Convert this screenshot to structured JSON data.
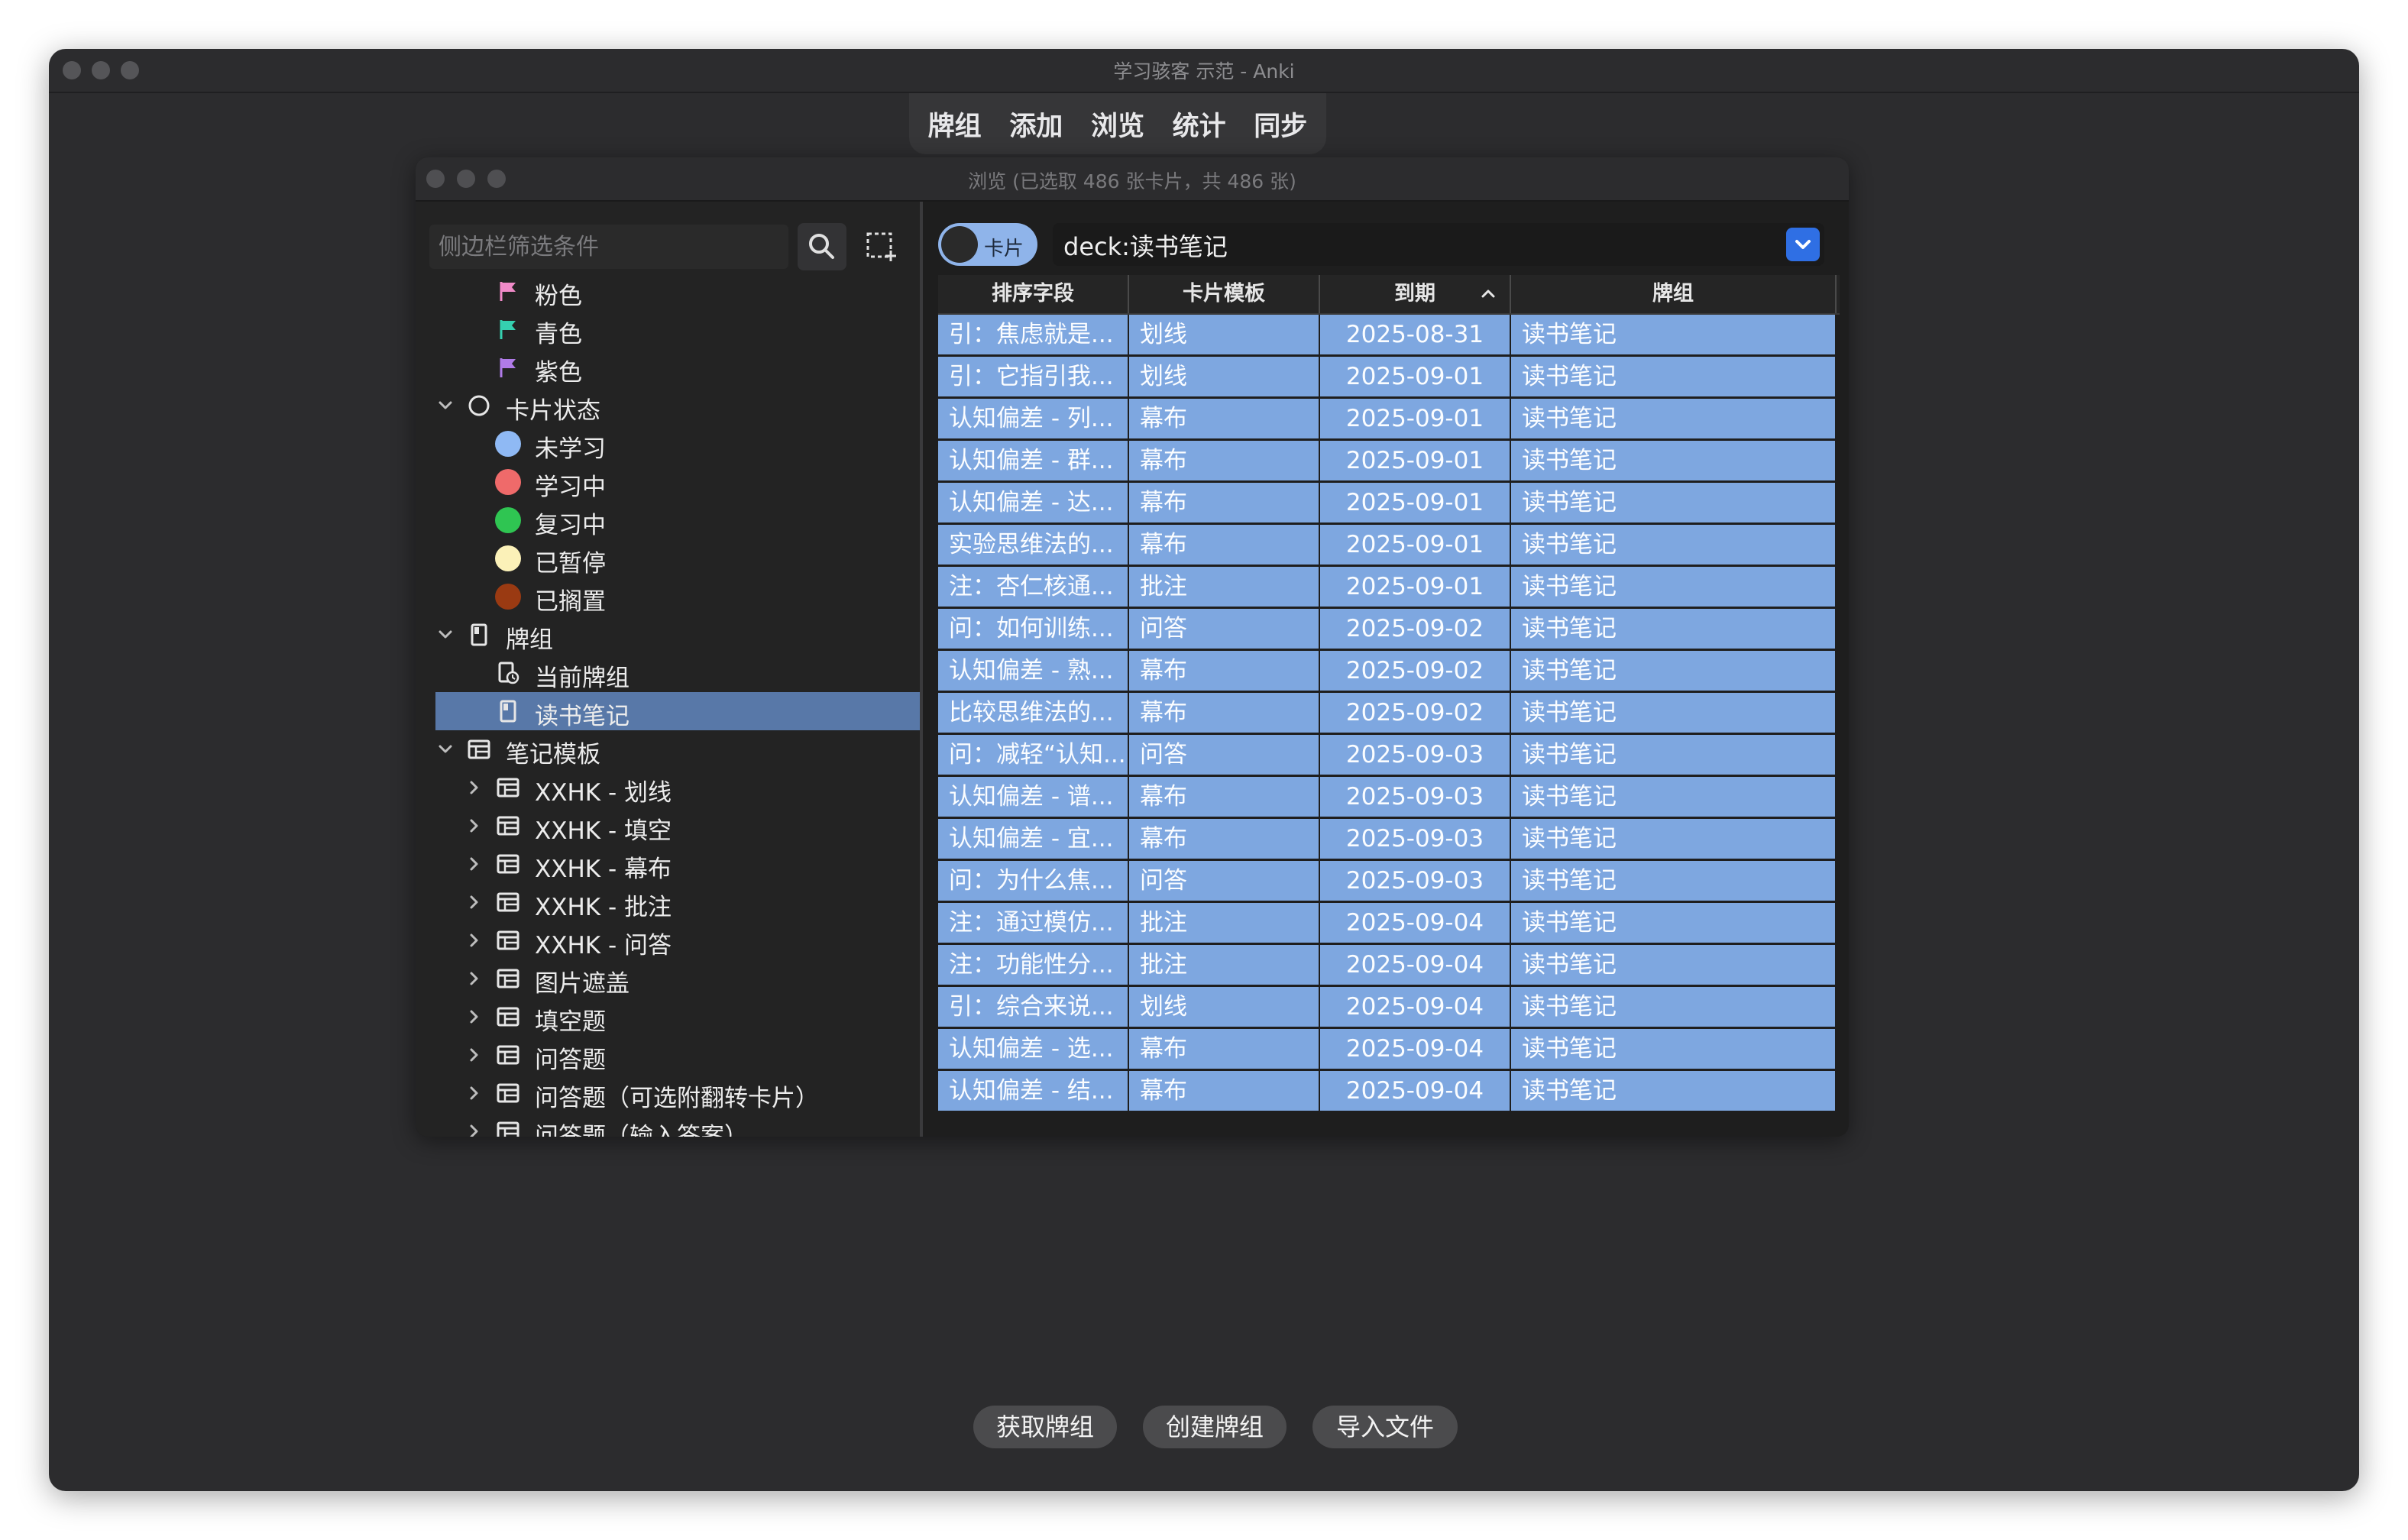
{
  "window": {
    "title": "学习骇客 示范 - Anki"
  },
  "toolbar": {
    "items": [
      "牌组",
      "添加",
      "浏览",
      "统计",
      "同步"
    ]
  },
  "browser": {
    "title": "浏览 (已选取 486 张卡片，共 486 张)",
    "sidebar": {
      "search_placeholder": "侧边栏筛选条件",
      "tree": [
        {
          "label": "粉色",
          "level": 2,
          "icon": "flag-icon",
          "color": "#f08ac8"
        },
        {
          "label": "青色",
          "level": 2,
          "icon": "flag-icon",
          "color": "#35d0b0"
        },
        {
          "label": "紫色",
          "level": 2,
          "icon": "flag-icon",
          "color": "#b07be8"
        },
        {
          "label": "卡片状态",
          "level": 1,
          "icon": "circle-outline-icon",
          "expanded": true
        },
        {
          "label": "未学习",
          "level": 2,
          "icon": "dot-icon",
          "color": "#8fb9f4"
        },
        {
          "label": "学习中",
          "level": 2,
          "icon": "dot-icon",
          "color": "#ef6a6a"
        },
        {
          "label": "复习中",
          "level": 2,
          "icon": "dot-icon",
          "color": "#2fc552"
        },
        {
          "label": "已暂停",
          "level": 2,
          "icon": "dot-icon",
          "color": "#fbf1b8"
        },
        {
          "label": "已搁置",
          "level": 2,
          "icon": "dot-icon",
          "color": "#9a3a12"
        },
        {
          "label": "牌组",
          "level": 1,
          "icon": "deck-icon",
          "expanded": true
        },
        {
          "label": "当前牌组",
          "level": 2,
          "icon": "current-deck-icon"
        },
        {
          "label": "读书笔记",
          "level": 2,
          "icon": "deck-icon",
          "selected": true
        },
        {
          "label": "笔记模板",
          "level": 1,
          "icon": "notetype-icon",
          "expanded": true
        },
        {
          "label": "XXHK - 划线",
          "level": 2,
          "icon": "notetype-icon",
          "collapsed": true
        },
        {
          "label": "XXHK - 填空",
          "level": 2,
          "icon": "notetype-icon",
          "collapsed": true
        },
        {
          "label": "XXHK - 幕布",
          "level": 2,
          "icon": "notetype-icon",
          "collapsed": true
        },
        {
          "label": "XXHK - 批注",
          "level": 2,
          "icon": "notetype-icon",
          "collapsed": true
        },
        {
          "label": "XXHK - 问答",
          "level": 2,
          "icon": "notetype-icon",
          "collapsed": true
        },
        {
          "label": "图片遮盖",
          "level": 2,
          "icon": "notetype-icon",
          "collapsed": true
        },
        {
          "label": "填空题",
          "level": 2,
          "icon": "notetype-icon",
          "collapsed": true
        },
        {
          "label": "问答题",
          "level": 2,
          "icon": "notetype-icon",
          "collapsed": true
        },
        {
          "label": "问答题（可选附翻转卡片）",
          "level": 2,
          "icon": "notetype-icon",
          "collapsed": true
        },
        {
          "label": "问答题（输入答案）",
          "level": 2,
          "icon": "notetype-icon",
          "collapsed": true
        }
      ]
    },
    "toggle_label": "卡片",
    "search_query": "deck:读书笔记",
    "columns": [
      "排序字段",
      "卡片模板",
      "到期",
      "牌组"
    ],
    "rows": [
      [
        "引：焦虑就是...",
        "划线",
        "2025-08-31",
        "读书笔记"
      ],
      [
        "引：它指引我...",
        "划线",
        "2025-09-01",
        "读书笔记"
      ],
      [
        "认知偏差 - 列...",
        "幕布",
        "2025-09-01",
        "读书笔记"
      ],
      [
        "认知偏差 - 群...",
        "幕布",
        "2025-09-01",
        "读书笔记"
      ],
      [
        "认知偏差 - 达...",
        "幕布",
        "2025-09-01",
        "读书笔记"
      ],
      [
        "实验思维法的...",
        "幕布",
        "2025-09-01",
        "读书笔记"
      ],
      [
        "注：杏仁核通...",
        "批注",
        "2025-09-01",
        "读书笔记"
      ],
      [
        "问：如何训练...",
        "问答",
        "2025-09-02",
        "读书笔记"
      ],
      [
        "认知偏差 - 熟...",
        "幕布",
        "2025-09-02",
        "读书笔记"
      ],
      [
        "比较思维法的...",
        "幕布",
        "2025-09-02",
        "读书笔记"
      ],
      [
        "问：减轻“认知...",
        "问答",
        "2025-09-03",
        "读书笔记"
      ],
      [
        "认知偏差 - 谱...",
        "幕布",
        "2025-09-03",
        "读书笔记"
      ],
      [
        "认知偏差 - 宜...",
        "幕布",
        "2025-09-03",
        "读书笔记"
      ],
      [
        "问：为什么焦...",
        "问答",
        "2025-09-03",
        "读书笔记"
      ],
      [
        "注：通过模仿...",
        "批注",
        "2025-09-04",
        "读书笔记"
      ],
      [
        "注：功能性分...",
        "批注",
        "2025-09-04",
        "读书笔记"
      ],
      [
        "引：综合来说...",
        "划线",
        "2025-09-04",
        "读书笔记"
      ],
      [
        "认知偏差 - 选...",
        "幕布",
        "2025-09-04",
        "读书笔记"
      ],
      [
        "认知偏差 - 结...",
        "幕布",
        "2025-09-04",
        "读书笔记"
      ]
    ]
  },
  "bottom_buttons": [
    "获取牌组",
    "创建牌组",
    "导入文件"
  ],
  "colors": {
    "selection_row": "#7ea7e0",
    "sidebar_selected": "#5878a8",
    "accent": "#2f6fe4"
  }
}
